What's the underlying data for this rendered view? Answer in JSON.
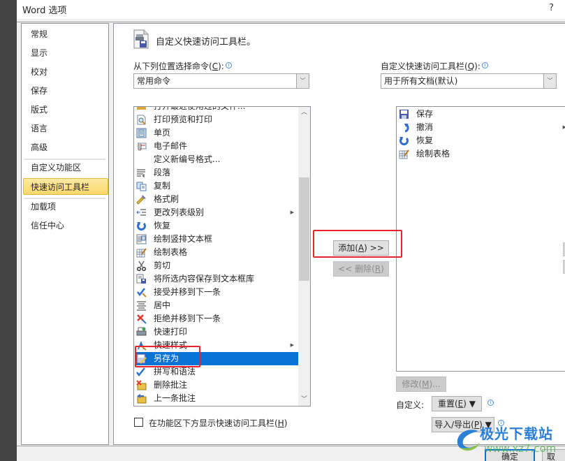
{
  "window": {
    "title": "Word 选项",
    "help_label": "?"
  },
  "nav": {
    "items": [
      {
        "label": "常规"
      },
      {
        "label": "显示"
      },
      {
        "label": "校对"
      },
      {
        "label": "保存"
      },
      {
        "label": "版式"
      },
      {
        "label": "语言"
      },
      {
        "label": "高级"
      },
      {
        "label": "自定义功能区"
      },
      {
        "label": "快速访问工具栏",
        "active": true
      },
      {
        "label": "加载项"
      },
      {
        "label": "信任中心"
      }
    ]
  },
  "main": {
    "header": "自定义快速访问工具栏。",
    "choose_label": "从下列位置选择命令(",
    "choose_key": "C",
    "choose_suffix": "):",
    "choose_value": "常用命令",
    "customize_label": "自定义快速访问工具栏(",
    "customize_key": "Q",
    "customize_suffix": "):",
    "customize_value": "用于所有文档(默认)",
    "commands": [
      {
        "label": "打开最近使用过的文件...",
        "icon": "open-recent-icon",
        "partial": true
      },
      {
        "label": "打印预览和打印",
        "icon": "print-preview-icon"
      },
      {
        "label": "单页",
        "icon": "single-page-icon"
      },
      {
        "label": "电子邮件",
        "icon": "email-icon"
      },
      {
        "label": "定义新编号格式...",
        "icon": ""
      },
      {
        "label": "段落",
        "icon": "paragraph-icon"
      },
      {
        "label": "复制",
        "icon": "copy-icon"
      },
      {
        "label": "格式刷",
        "icon": "format-painter-icon"
      },
      {
        "label": "更改列表级别",
        "icon": "list-level-icon",
        "submenu": true
      },
      {
        "label": "恢复",
        "icon": "redo-icon"
      },
      {
        "label": "绘制竖排文本框",
        "icon": "vertical-textbox-icon"
      },
      {
        "label": "绘制表格",
        "icon": "draw-table-icon"
      },
      {
        "label": "剪切",
        "icon": "cut-icon"
      },
      {
        "label": "将所选内容保存到文本框库",
        "icon": "save-to-gallery-icon"
      },
      {
        "label": "接受并移到下一条",
        "icon": "accept-next-icon"
      },
      {
        "label": "居中",
        "icon": "center-align-icon"
      },
      {
        "label": "拒绝并移到下一条",
        "icon": "reject-next-icon"
      },
      {
        "label": "快速打印",
        "icon": "quick-print-icon"
      },
      {
        "label": "快速样式",
        "icon": "quick-styles-icon",
        "submenu": true
      },
      {
        "label": "另存为",
        "icon": "save-as-icon",
        "selected": true
      },
      {
        "label": "拼写和语法",
        "icon": "spelling-icon"
      },
      {
        "label": "删除批注",
        "icon": "delete-comment-icon"
      },
      {
        "label": "上一条批注",
        "icon": "previous-comment-icon"
      }
    ],
    "toolbar_items": [
      {
        "label": "保存",
        "icon": "save-icon"
      },
      {
        "label": "撤消",
        "icon": "undo-icon",
        "submenu": true
      },
      {
        "label": "恢复",
        "icon": "redo-icon"
      },
      {
        "label": "绘制表格",
        "icon": "draw-table-icon"
      }
    ],
    "add_button": "添加(A) >>",
    "add_label": "添加(",
    "add_key": "A",
    "add_suffix": ") >>",
    "remove_prefix": "<< 删除(",
    "remove_key": "R",
    "remove_suffix": ")",
    "modify_prefix": "修改(",
    "modify_key": "M",
    "modify_suffix": ")...",
    "customize_row_label": "自定义:",
    "reset_prefix": "重置(",
    "reset_key": "E",
    "reset_suffix": ") ▼",
    "import_prefix": "导入/导出(",
    "import_key": "P",
    "import_suffix": ") ▼",
    "show_below_prefix": "在功能区下方显示快速访问工具栏(",
    "show_below_key": "H",
    "show_below_suffix": ")",
    "show_below_checked": false
  },
  "footer": {
    "ok_label": "确定",
    "cancel_label": "取"
  },
  "watermark": {
    "text": "极光下载站",
    "url": "www.xz7.com"
  },
  "colors": {
    "selection": "#0a74d6",
    "nav_active": "#fbd76b",
    "annotation": "#e8242a"
  }
}
